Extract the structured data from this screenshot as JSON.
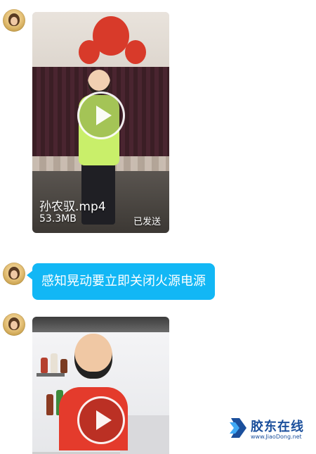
{
  "messages": [
    {
      "type": "video",
      "file_name": "孙农驭.mp4",
      "file_size": "53.3MB",
      "status": "已发送"
    },
    {
      "type": "text",
      "text": "感知晃动要立即关闭火源电源"
    },
    {
      "type": "video"
    }
  ],
  "watermark": {
    "cn": "胶东在线",
    "en": "www.JiaoDong.net"
  },
  "colors": {
    "bubble": "#12b7f5",
    "background": "#ffffff",
    "watermark": "#1b4f9c"
  },
  "icons": [
    "avatar",
    "play-icon",
    "jiaodong-logo"
  ]
}
